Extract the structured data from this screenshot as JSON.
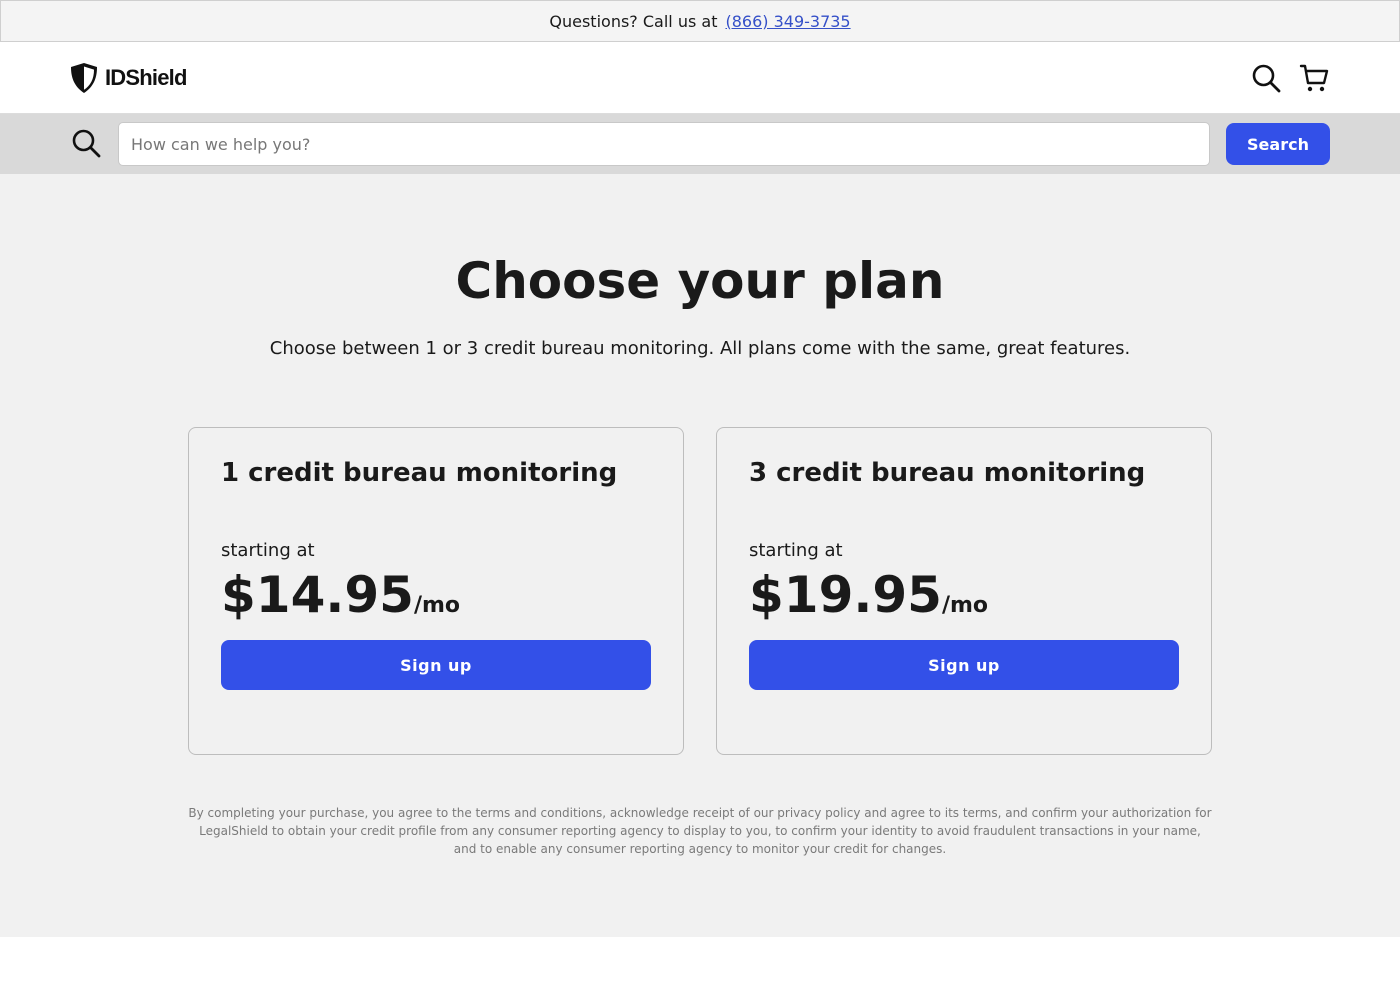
{
  "topbar": {
    "text": "Questions? Call us at",
    "phone": "(866) 349-3735"
  },
  "header": {
    "logo_text": "IDShield",
    "logo_icon": "shield-icon",
    "icons": [
      "search-icon",
      "cart-icon"
    ]
  },
  "search": {
    "icon": "search-icon",
    "placeholder": "How can we help you?",
    "value": "",
    "button_label": "Search"
  },
  "main": {
    "title": "Choose your plan",
    "subtitle": "Choose between 1 or 3 credit bureau monitoring. All plans come with the same, great features.",
    "plans": [
      {
        "title": "1 credit bureau monitoring",
        "starting_label": "starting at",
        "price": "$14.95",
        "unit": "/mo",
        "button_label": "Sign up"
      },
      {
        "title": "3 credit bureau monitoring",
        "starting_label": "starting at",
        "price": "$19.95",
        "unit": "/mo",
        "button_label": "Sign up"
      }
    ],
    "disclaimer": "By completing your purchase, you agree to the terms and conditions, acknowledge receipt of our privacy policy and agree to its terms, and confirm your authorization for LegalShield to obtain your credit profile from any consumer reporting agency to display to you, to confirm your identity to avoid fraudulent transactions in your name, and to enable any consumer reporting agency to monitor your credit for changes."
  },
  "colors": {
    "accent": "#3350e8",
    "link": "#3550c8",
    "background": "#f1f1f1",
    "search_band": "#d9d9d9"
  }
}
